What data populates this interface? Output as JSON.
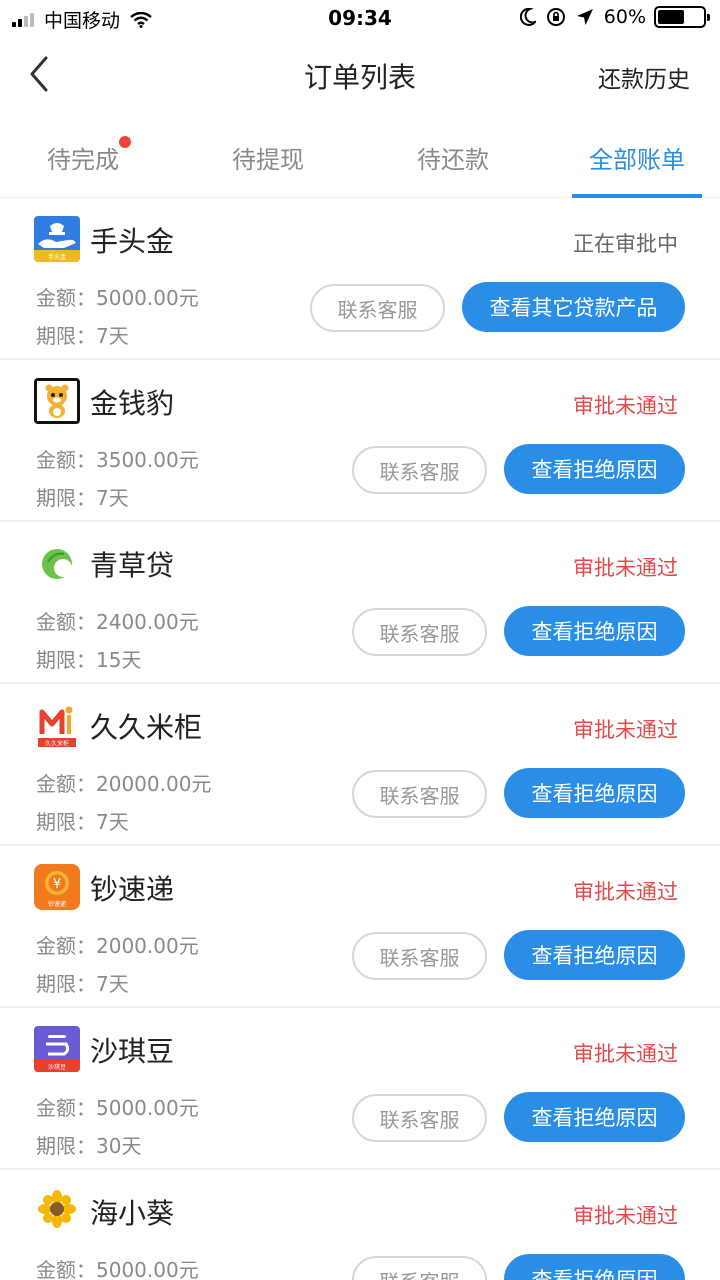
{
  "status_bar": {
    "carrier": "中国移动",
    "time": "09:34",
    "battery": "60%",
    "battery_level": 0.6
  },
  "nav": {
    "title": "订单列表",
    "right_link": "还款历史"
  },
  "tabs": [
    {
      "label": "待完成",
      "has_dot": true,
      "active": false
    },
    {
      "label": "待提现",
      "has_dot": false,
      "active": false
    },
    {
      "label": "待还款",
      "has_dot": false,
      "active": false
    },
    {
      "label": "全部账单",
      "has_dot": false,
      "active": true
    }
  ],
  "colors": {
    "accent": "#2a8ee6",
    "rejected": "#e04b4b",
    "badge": "#f0443a"
  },
  "orders": [
    {
      "name": "手头金",
      "status": "正在审批中",
      "amount": "金额：5000.00元",
      "term": "期限：7天",
      "contact_label": "联系客服",
      "action_label": "查看其它贷款产品",
      "logo_icon": "hand-coin-icon",
      "logo_text": "手头金"
    },
    {
      "name": "金钱豹",
      "status": "审批未通过",
      "amount": "金额：3500.00元",
      "term": "期限：7天",
      "contact_label": "联系客服",
      "action_label": "查看拒绝原因",
      "logo_icon": "leopard-icon"
    },
    {
      "name": "青草贷",
      "status": "审批未通过",
      "amount": "金额：2400.00元",
      "term": "期限：15天",
      "contact_label": "联系客服",
      "action_label": "查看拒绝原因",
      "logo_icon": "grass-leaf-icon"
    },
    {
      "name": "久久米柜",
      "status": "审批未通过",
      "amount": "金额：20000.00元",
      "term": "期限：7天",
      "contact_label": "联系客服",
      "action_label": "查看拒绝原因",
      "logo_icon": "m-letter-icon",
      "logo_text": "久久米柜"
    },
    {
      "name": "钞速递",
      "status": "审批未通过",
      "amount": "金额：2000.00元",
      "term": "期限：7天",
      "contact_label": "联系客服",
      "action_label": "查看拒绝原因",
      "logo_icon": "yuan-coin-icon",
      "logo_text": "钞速递"
    },
    {
      "name": "沙琪豆",
      "status": "审批未通过",
      "amount": "金额：5000.00元",
      "term": "期限：30天",
      "contact_label": "联系客服",
      "action_label": "查看拒绝原因",
      "logo_icon": "bean-icon",
      "logo_text": "沙琪豆"
    },
    {
      "name": "海小葵",
      "status": "审批未通过",
      "amount": "金额：5000.00元",
      "term": "",
      "contact_label": "联系客服",
      "action_label": "查看拒绝原因",
      "logo_icon": "sunflower-icon"
    }
  ]
}
